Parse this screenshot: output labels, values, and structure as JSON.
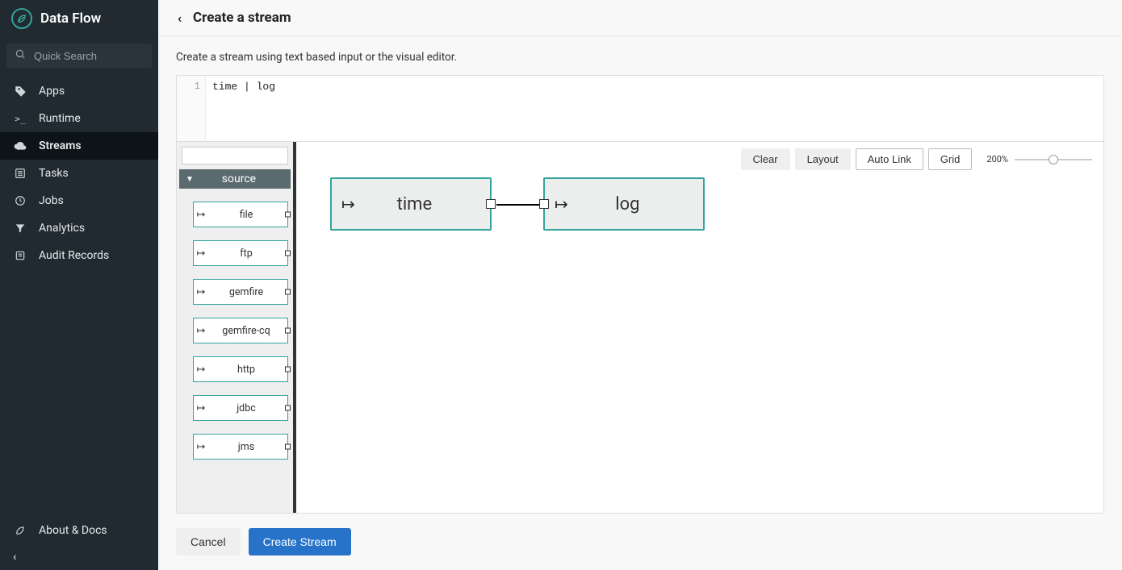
{
  "brand": {
    "name": "Data Flow"
  },
  "search": {
    "placeholder": "Quick Search"
  },
  "sidebar": {
    "items": [
      {
        "label": "Apps",
        "icon": "tag-icon",
        "active": false
      },
      {
        "label": "Runtime",
        "icon": "terminal-icon",
        "active": false
      },
      {
        "label": "Streams",
        "icon": "cloud-icon",
        "active": true
      },
      {
        "label": "Tasks",
        "icon": "list-icon",
        "active": false
      },
      {
        "label": "Jobs",
        "icon": "clock-icon",
        "active": false
      },
      {
        "label": "Analytics",
        "icon": "filter-icon",
        "active": false
      },
      {
        "label": "Audit Records",
        "icon": "records-icon",
        "active": false
      }
    ],
    "bottom": {
      "about": "About & Docs"
    }
  },
  "page": {
    "title": "Create a stream",
    "description": "Create a stream using text based input or the visual editor."
  },
  "text_editor": {
    "line_no": "1",
    "code": "time | log"
  },
  "palette": {
    "search_value": "",
    "category": "source",
    "items": [
      "file",
      "ftp",
      "gemfire",
      "gemfire-cq",
      "http",
      "jdbc",
      "jms"
    ]
  },
  "toolbar": {
    "clear": "Clear",
    "layout": "Layout",
    "autolink": "Auto Link",
    "grid": "Grid",
    "zoom": "200%"
  },
  "canvas": {
    "nodes": [
      {
        "label": "time",
        "has_in": false,
        "has_out": true
      },
      {
        "label": "log",
        "has_in": true,
        "has_out": false
      }
    ]
  },
  "actions": {
    "cancel": "Cancel",
    "create": "Create Stream"
  }
}
